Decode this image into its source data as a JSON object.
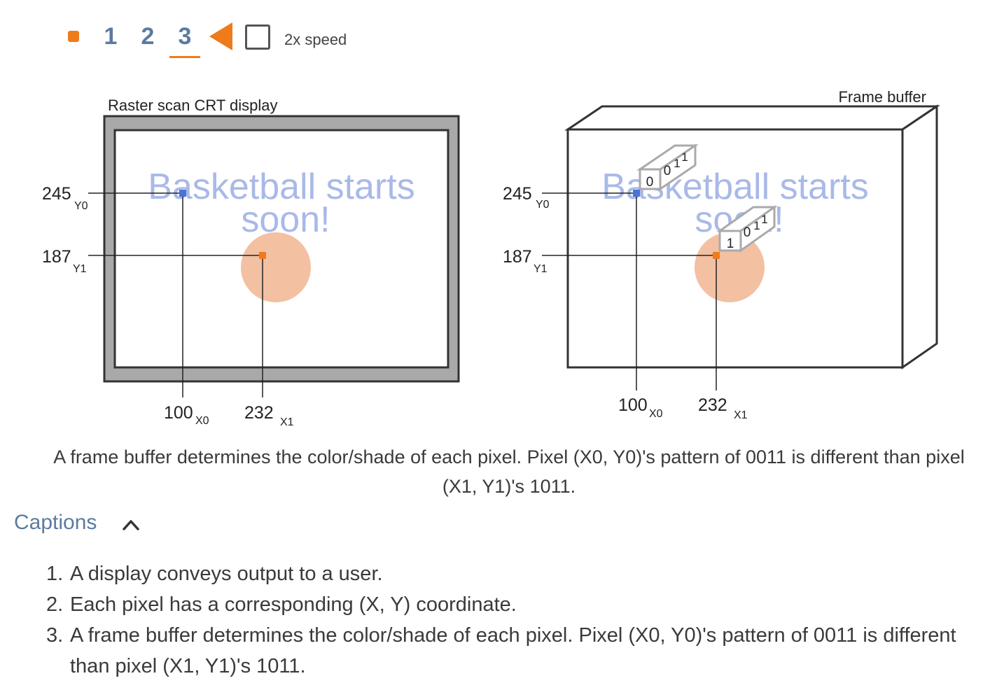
{
  "controls": {
    "steps": [
      "1",
      "2",
      "3"
    ],
    "active_step": 3,
    "speed_label": "2x speed",
    "speed_checked": false,
    "accent_color": "#ef7b1c",
    "icons": [
      "stop-icon",
      "back-triangle-icon",
      "checkbox-icon"
    ]
  },
  "figure": {
    "crt_title": "Raster scan CRT display",
    "fb_title": "Frame buffer",
    "screen_text_line1": "Basketball starts",
    "screen_text_line2": "soon!",
    "crt": {
      "y0_value": "245",
      "y0_sub": "Y0",
      "y1_value": "187",
      "y1_sub": "Y1",
      "x0_value": "100",
      "x0_sub": "X0",
      "x1_value": "232",
      "x1_sub": "X1"
    },
    "fb": {
      "y0_value": "245",
      "y0_sub": "Y0",
      "y1_value": "187",
      "y1_sub": "Y1",
      "x0_value": "100",
      "x0_sub": "X0",
      "x1_value": "232",
      "x1_sub": "X1"
    },
    "bits_p0": [
      "0",
      "0",
      "1",
      "1"
    ],
    "bits_p1": [
      "1",
      "0",
      "1",
      "1"
    ],
    "colors": {
      "text_blue": "#a9b9e8",
      "ball": "#f3c0a2",
      "pixel0": "#4a73d9",
      "pixel1": "#ef7b1c",
      "bezel": "#a9a9a9"
    }
  },
  "explanation": "A frame buffer determines the color/shade of each pixel. Pixel (X0, Y0)'s pattern of 0011 is different than pixel (X1, Y1)'s 1011.",
  "captions": {
    "header": "Captions",
    "items": [
      {
        "num": "1.",
        "text": "A display conveys output to a user."
      },
      {
        "num": "2.",
        "text": "Each pixel has a corresponding (X, Y) coordinate."
      },
      {
        "num": "3.",
        "text": "A frame buffer determines the color/shade of each pixel. Pixel (X0, Y0)'s pattern of 0011 is different than pixel (X1, Y1)'s 1011."
      }
    ]
  }
}
